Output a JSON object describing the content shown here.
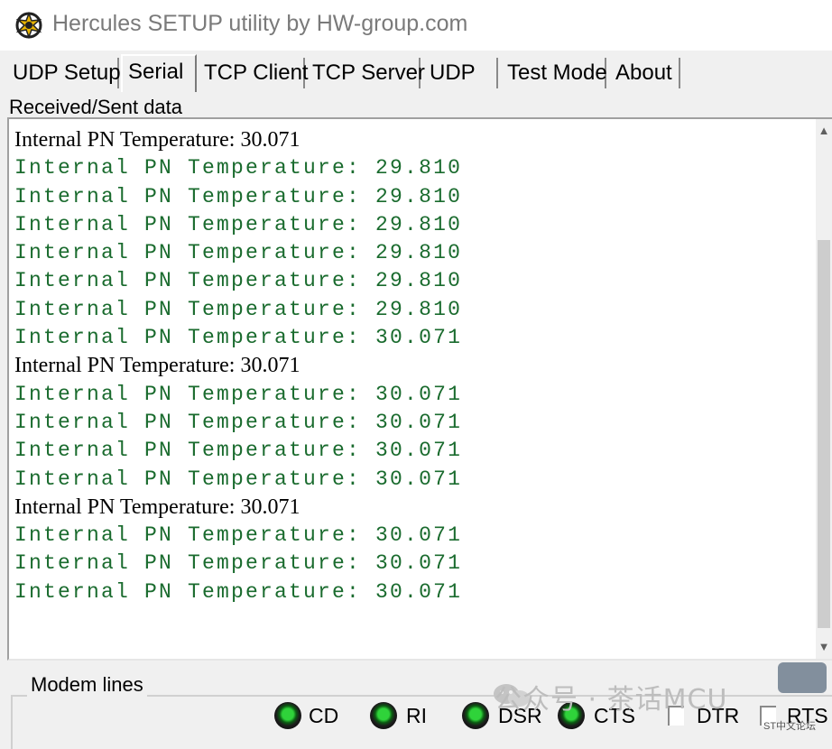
{
  "window": {
    "title": "Hercules SETUP utility by HW-group.com"
  },
  "tabs": [
    {
      "label": "UDP Setup"
    },
    {
      "label": "Serial"
    },
    {
      "label": "TCP Client"
    },
    {
      "label": "TCP Server"
    },
    {
      "label": "UDP"
    },
    {
      "label": "Test Mode"
    },
    {
      "label": "About"
    }
  ],
  "active_tab": "Serial",
  "received": {
    "label": "Received/Sent data",
    "lines": [
      {
        "text": "Internal PN Temperature: 30.071",
        "kind": "sent"
      },
      {
        "text": "Internal PN Temperature: 29.810",
        "kind": "received"
      },
      {
        "text": "Internal PN Temperature: 29.810",
        "kind": "received"
      },
      {
        "text": "Internal PN Temperature: 29.810",
        "kind": "received"
      },
      {
        "text": "Internal PN Temperature: 29.810",
        "kind": "received"
      },
      {
        "text": "Internal PN Temperature: 29.810",
        "kind": "received"
      },
      {
        "text": "Internal PN Temperature: 29.810",
        "kind": "received"
      },
      {
        "text": "Internal PN Temperature: 30.071",
        "kind": "received"
      },
      {
        "text": "Internal PN Temperature: 30.071",
        "kind": "sent"
      },
      {
        "text": "Internal PN Temperature: 30.071",
        "kind": "received"
      },
      {
        "text": "Internal PN Temperature: 30.071",
        "kind": "received"
      },
      {
        "text": "Internal PN Temperature: 30.071",
        "kind": "received"
      },
      {
        "text": "Internal PN Temperature: 30.071",
        "kind": "received"
      },
      {
        "text": "Internal PN Temperature: 30.071",
        "kind": "sent"
      },
      {
        "text": "Internal PN Temperature: 30.071",
        "kind": "received"
      },
      {
        "text": "Internal PN Temperature: 30.071",
        "kind": "received"
      },
      {
        "text": "Internal PN Temperature: 30.071",
        "kind": "received"
      }
    ]
  },
  "modem": {
    "label": "Modem lines",
    "indicators": [
      {
        "label": "CD",
        "icon": "led-green-icon"
      },
      {
        "label": "RI",
        "icon": "led-green-icon"
      },
      {
        "label": "DSR",
        "icon": "led-green-icon"
      },
      {
        "label": "CTS",
        "icon": "led-green-icon"
      }
    ],
    "checkboxes": [
      {
        "label": "DTR",
        "checked": false
      },
      {
        "label": "RTS",
        "checked": false
      }
    ]
  },
  "watermark": {
    "text": "公众号 · 茶话MCU",
    "small": "ST中文论坛"
  },
  "colors": {
    "received_text": "#1a6b2e",
    "sent_text": "#000000",
    "led": "#2fd33a"
  }
}
